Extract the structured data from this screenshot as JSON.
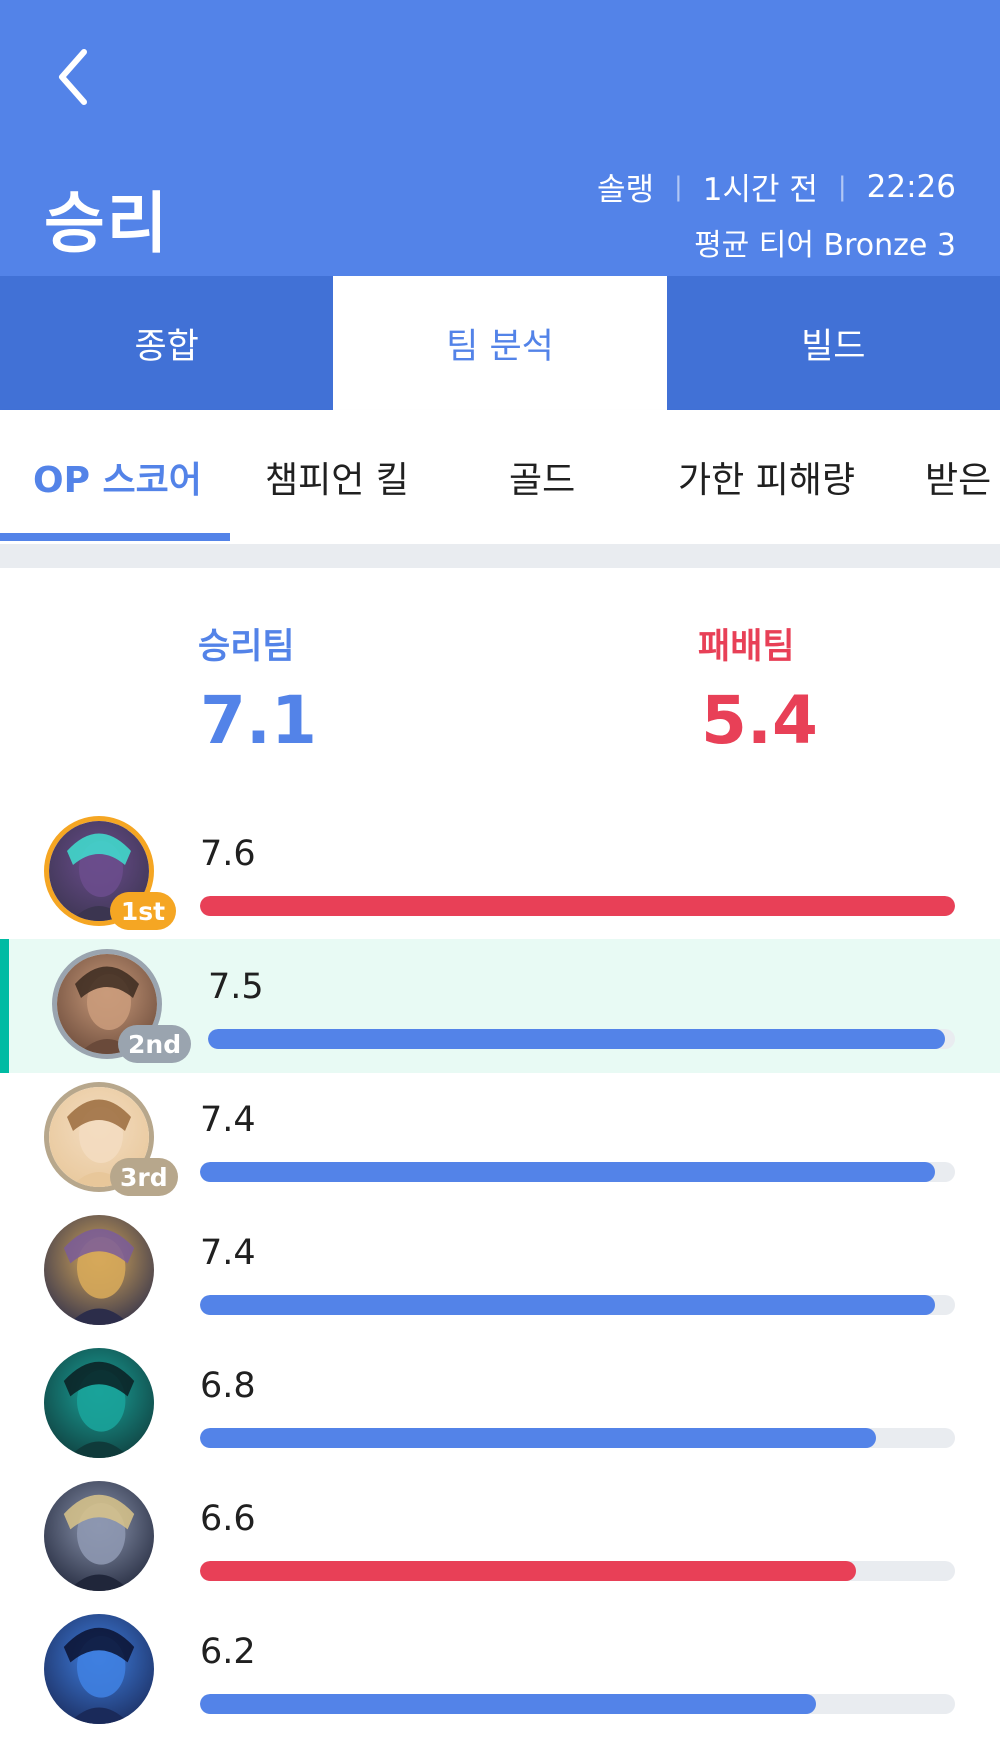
{
  "header": {
    "result": "승리",
    "queue": "솔랭",
    "time_ago": "1시간 전",
    "duration": "22:26",
    "avg_tier": "평균 티어 Bronze 3",
    "background": "#5383e8"
  },
  "tabs": [
    {
      "label": "종합",
      "active": false
    },
    {
      "label": "팀 분석",
      "active": true
    },
    {
      "label": "빌드",
      "active": false
    }
  ],
  "subtabs": [
    {
      "label": "OP 스코어",
      "active": true
    },
    {
      "label": "챔피언 킬",
      "active": false
    },
    {
      "label": "골드",
      "active": false
    },
    {
      "label": "가한 피해량",
      "active": false
    },
    {
      "label": "받은",
      "active": false
    }
  ],
  "teams": {
    "win": {
      "label": "승리팀",
      "score": "7.1",
      "color": "#5383e8"
    },
    "lose": {
      "label": "패배팀",
      "score": "5.4",
      "color": "#e84057"
    }
  },
  "players": [
    {
      "score": "7.6",
      "value": 7.6,
      "team": "lose",
      "rank": "1st",
      "icon": "dark-armored-champion-icon",
      "highlight": false
    },
    {
      "score": "7.5",
      "value": 7.5,
      "team": "win",
      "rank": "2nd",
      "icon": "brown-haired-champion-icon",
      "highlight": true
    },
    {
      "score": "7.4",
      "value": 7.4,
      "team": "win",
      "rank": "3rd",
      "icon": "blonde-champion-icon",
      "highlight": false
    },
    {
      "score": "7.4",
      "value": 7.4,
      "team": "win",
      "rank": "",
      "icon": "golden-haired-champion-icon",
      "highlight": false
    },
    {
      "score": "6.8",
      "value": 6.8,
      "team": "win",
      "rank": "",
      "icon": "teal-armored-champion-icon",
      "highlight": false
    },
    {
      "score": "6.6",
      "value": 6.6,
      "team": "lose",
      "rank": "",
      "icon": "helmeted-champion-icon",
      "highlight": false
    },
    {
      "score": "6.2",
      "value": 6.2,
      "team": "win",
      "rank": "",
      "icon": "blue-armored-champion-icon",
      "highlight": false
    }
  ],
  "bar_max": 7.6,
  "colors": {
    "win_bar": "#5383e8",
    "lose_bar": "#e84057",
    "track": "#e9ecf0",
    "highlight_bg": "#e8faf4",
    "highlight_marker": "#00bba3",
    "rank_gold": "#f5a623",
    "rank_silver": "#9aa4af",
    "rank_bronze": "#b7a78c"
  }
}
